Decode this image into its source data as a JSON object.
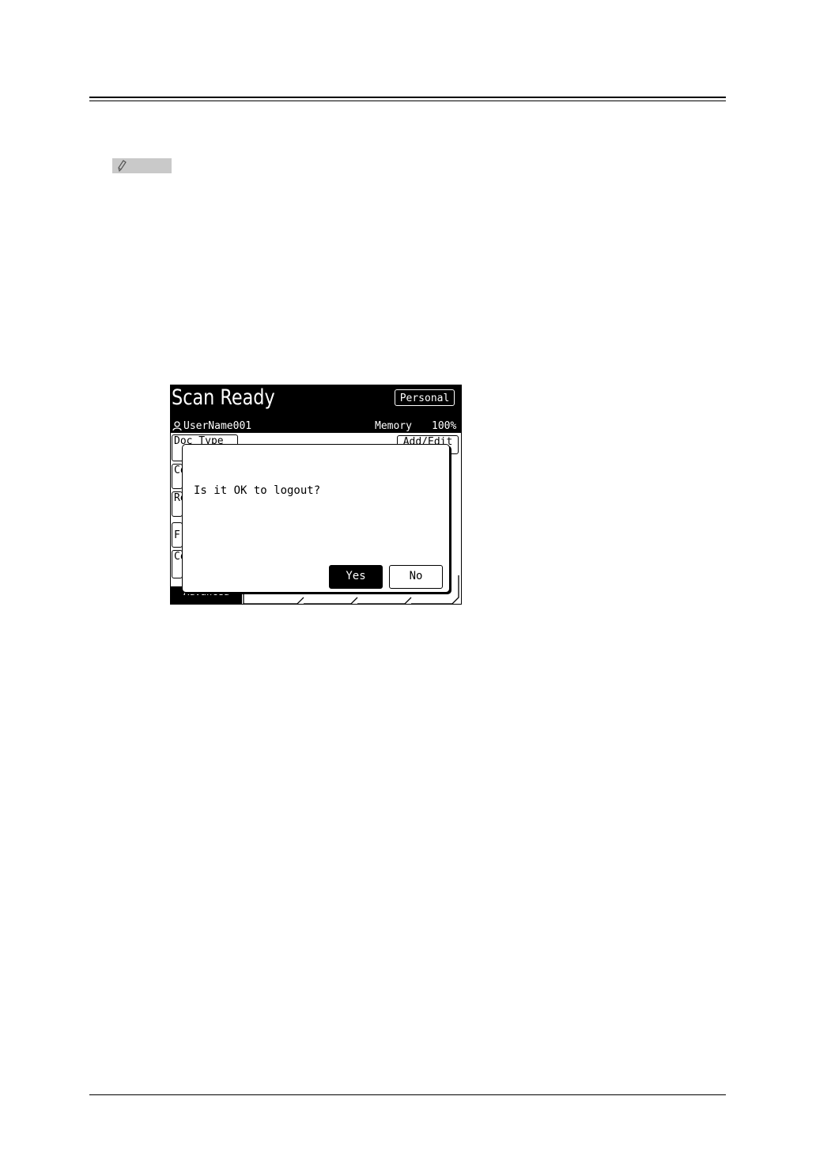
{
  "screen": {
    "title": "Scan Ready",
    "personal_button": "Personal",
    "user_name": "UserName001",
    "memory_label": "Memory",
    "memory_value": "100%",
    "doc_type_button": "Doc Type",
    "add_edit_button": "Add/Edit",
    "side_buttons": [
      "Co",
      "Re",
      "F",
      "Co"
    ],
    "advanced_tab": "Advanced"
  },
  "dialog": {
    "message": "Is it OK to logout?",
    "yes_label": "Yes",
    "no_label": "No"
  },
  "icons": {
    "note": "pencil-icon",
    "user": "user-icon"
  }
}
